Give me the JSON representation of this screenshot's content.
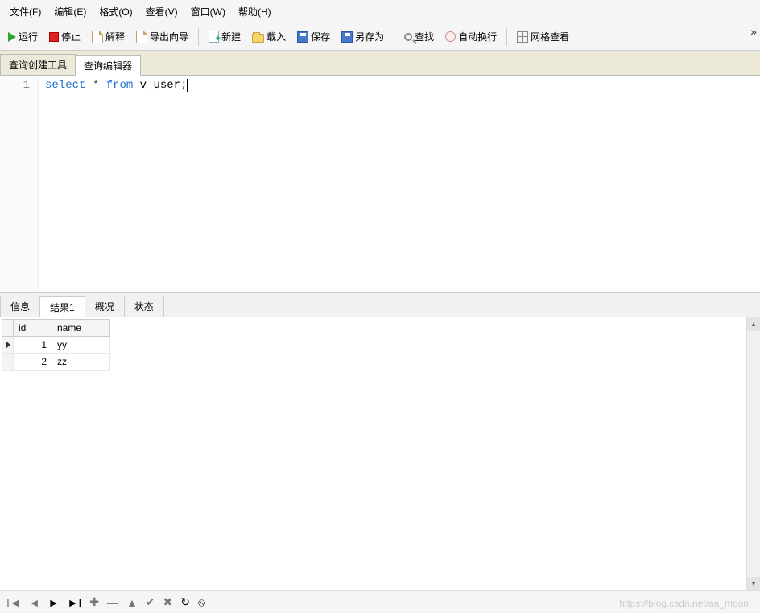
{
  "menu": {
    "file": "文件(F)",
    "edit": "编辑(E)",
    "format": "格式(O)",
    "view": "查看(V)",
    "window": "窗口(W)",
    "help": "帮助(H)"
  },
  "toolbar": {
    "run": "运行",
    "stop": "停止",
    "explain": "解释",
    "export_wizard": "导出向导",
    "new": "新建",
    "load": "载入",
    "save": "保存",
    "save_as": "另存为",
    "find": "查找",
    "auto_wrap": "自动换行",
    "grid_view": "网格查看"
  },
  "editor_tabs": {
    "builder": "查询创建工具",
    "editor": "查询编辑器"
  },
  "code": {
    "line_no": "1",
    "text_kw1": "select",
    "text_star": " * ",
    "text_kw2": "from",
    "text_ident": " v_user",
    "text_semi": ";"
  },
  "result_tabs": {
    "info": "信息",
    "result1": "结果1",
    "profile": "概况",
    "state": "状态"
  },
  "grid": {
    "headers": {
      "id": "id",
      "name": "name"
    },
    "rows": [
      {
        "id": "1",
        "name": "yy",
        "current": true
      },
      {
        "id": "2",
        "name": "zz",
        "current": false
      }
    ]
  },
  "nav": {
    "first": "I◄",
    "prev": "◄",
    "next": "►",
    "last": "►I",
    "plus": "✚",
    "minus": "—",
    "up": "▲",
    "check": "✔",
    "x": "✖",
    "refresh": "↻",
    "stop": "⦸"
  },
  "watermark": "https://blog.csdn.net/aa_moon"
}
